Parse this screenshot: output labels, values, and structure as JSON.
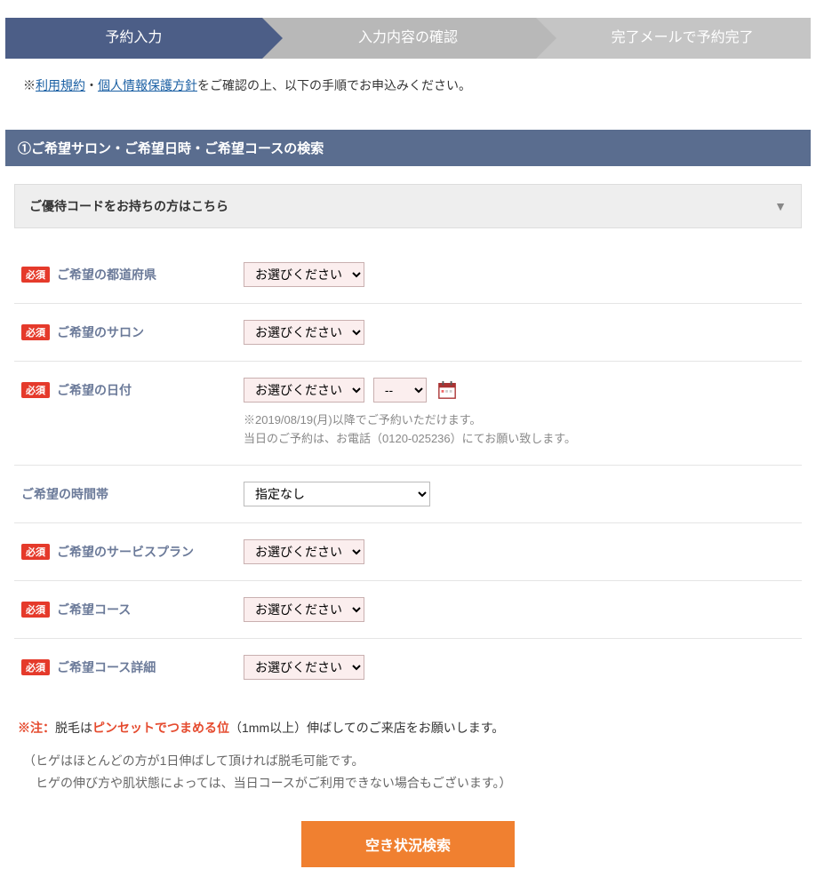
{
  "stepper": {
    "step1": "予約入力",
    "step2": "入力内容の確認",
    "step3": "完了メールで予約完了"
  },
  "intro": {
    "prefix": "※",
    "terms_link": "利用規約",
    "sep": "・",
    "privacy_link": "個人情報保護方針",
    "suffix": "をご確認の上、以下の手順でお申込みください。"
  },
  "section_header": "①ご希望サロン・ご希望日時・ご希望コースの検索",
  "coupon_bar": "ご優待コードをお持ちの方はこちら",
  "required_badge": "必須",
  "fields": {
    "pref": {
      "label": "ご希望の都道府県",
      "value": "お選びください"
    },
    "salon": {
      "label": "ご希望のサロン",
      "value": "お選びください"
    },
    "date": {
      "label": "ご希望の日付",
      "value": "お選びください",
      "dash": "--",
      "note1": "※2019/08/19(月)以降でご予約いただけます。",
      "note2": "当日のご予約は、お電話（0120-025236）にてお願い致します。"
    },
    "time": {
      "label": "ご希望の時間帯",
      "value": "指定なし"
    },
    "plan": {
      "label": "ご希望のサービスプラン",
      "value": "お選びください"
    },
    "course": {
      "label": "ご希望コース",
      "value": "お選びください"
    },
    "course_detail": {
      "label": "ご希望コース詳細",
      "value": "お選びください"
    }
  },
  "notice": {
    "prefix": "※注：",
    "text1": "脱毛は",
    "strong": "ピンセットでつまめる位",
    "text2": "（1mm以上）伸ばしてのご来店をお願いします。",
    "sub1": "（ヒゲはほとんどの方が1日伸ばして頂ければ脱毛可能です。",
    "sub2": "　ヒゲの伸び方や肌状態によっては、当日コースがご利用できない場合もございます。）"
  },
  "search_button": "空き状況検索"
}
